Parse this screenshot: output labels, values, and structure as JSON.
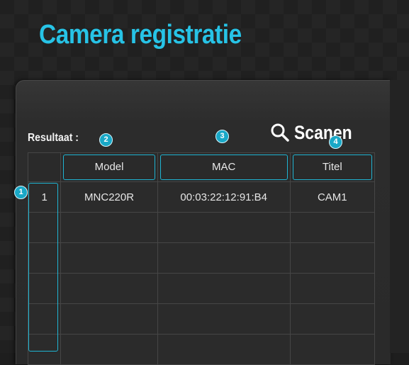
{
  "header": {
    "title": "Camera registratie"
  },
  "results": {
    "label": "Resultaat :"
  },
  "scan": {
    "label": "Scanen",
    "icon": "search-icon"
  },
  "table": {
    "columns": [
      "",
      "Model",
      "MAC",
      "Titel"
    ],
    "rows": [
      [
        "1",
        "MNC220R",
        "00:03:22:12:91:B4",
        "CAM1"
      ],
      [
        "",
        "",
        "",
        ""
      ],
      [
        "",
        "",
        "",
        ""
      ],
      [
        "",
        "",
        "",
        ""
      ],
      [
        "",
        "",
        "",
        ""
      ],
      [
        "",
        "",
        "",
        ""
      ]
    ]
  },
  "callouts": [
    "1",
    "2",
    "3",
    "4"
  ],
  "colors": {
    "accent": "#27c3e6",
    "highlight": "#1fb4d2",
    "badge": "#19a8c7"
  }
}
